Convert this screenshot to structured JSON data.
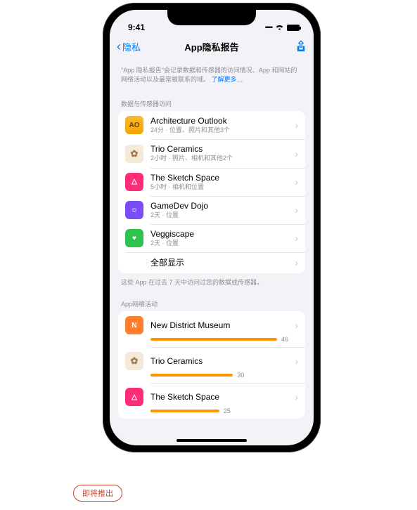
{
  "status": {
    "time": "9:41"
  },
  "nav": {
    "back_label": "隐私",
    "title": "App隐私报告"
  },
  "intro": {
    "text": "\"App 隐私报告\"会记录数据和传感器的访问情况、App 和网站的网络活动以及最常被联系的域。",
    "link": "了解更多…"
  },
  "section1": {
    "header": "数据与传感器访问"
  },
  "apps": [
    {
      "name": "Architecture Outlook",
      "sub": "24分 · 位置、照片和其他3个",
      "icon_style": "orange",
      "icon_text": "AO"
    },
    {
      "name": "Trio Ceramics",
      "sub": "2小时 · 照片、相机和其他2个",
      "icon_style": "beige",
      "icon_text": "✿"
    },
    {
      "name": "The Sketch Space",
      "sub": "5小时 · 相机和位置",
      "icon_style": "pink",
      "icon_text": "△"
    },
    {
      "name": "GameDev Dojo",
      "sub": "2天 · 位置",
      "icon_style": "purple",
      "icon_text": "☺"
    },
    {
      "name": "Veggiscape",
      "sub": "2天 · 位置",
      "icon_style": "green",
      "icon_text": "♥"
    }
  ],
  "show_all": "全部显示",
  "footnote": "这些 App 在过去 7 天中访问过您的数据或传感器。",
  "section2": {
    "header": "App网络活动"
  },
  "net": [
    {
      "name": "New District Museum",
      "count": 46,
      "icon_style": "oranger",
      "icon_text": "N"
    },
    {
      "name": "Trio Ceramics",
      "count": 30,
      "icon_style": "beige",
      "icon_text": "✿"
    },
    {
      "name": "The Sketch Space",
      "count": 25,
      "icon_style": "pink",
      "icon_text": "△"
    }
  ],
  "net_max": 46,
  "pill": "即将推出"
}
